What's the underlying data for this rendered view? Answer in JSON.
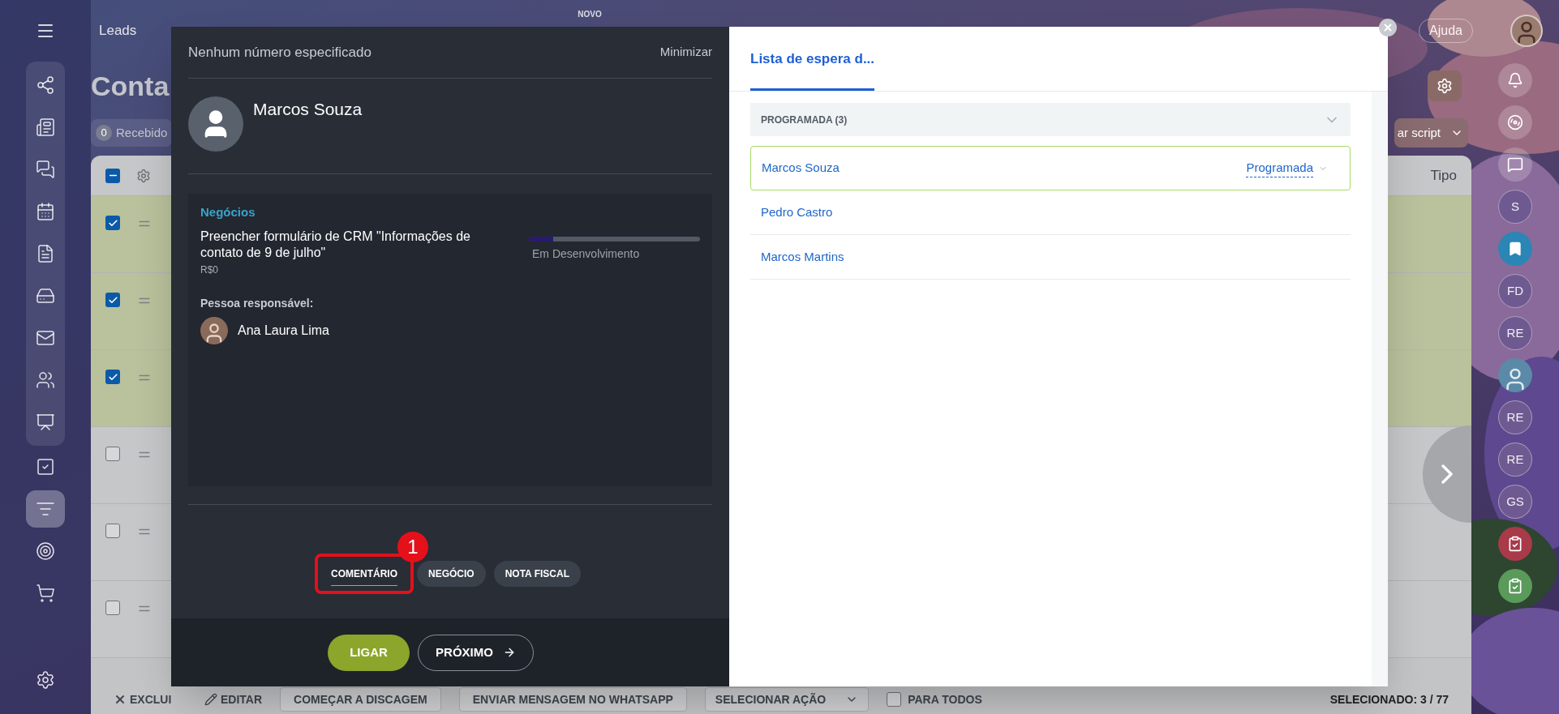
{
  "top_bar": {
    "nav_items": [
      {
        "label": "Leads"
      }
    ],
    "new_badge": "NOVO",
    "help_button": "Ajuda"
  },
  "left_sidebar": {
    "items": [
      {
        "selected": false
      },
      {
        "selected": false
      },
      {
        "selected": false
      },
      {
        "selected": false
      },
      {
        "selected": false
      },
      {
        "selected": false
      },
      {
        "selected": false
      },
      {
        "selected": false
      },
      {
        "selected": false
      },
      {
        "selected": false
      },
      {
        "selected": true
      },
      {
        "selected": false
      },
      {
        "selected": false
      }
    ]
  },
  "page": {
    "title": "Conta",
    "counter": {
      "count": "0",
      "label": "Recebido"
    },
    "script_button": "ar script"
  },
  "table": {
    "header_checkbox": {
      "indeterminate": true
    },
    "last_column": "Tipo",
    "rows": [
      {
        "checked": true
      },
      {
        "checked": true
      },
      {
        "checked": true
      },
      {
        "checked": false
      },
      {
        "checked": false
      },
      {
        "checked": false
      }
    ]
  },
  "bottom_bar": {
    "actions": [
      {
        "kind": "delete",
        "label": "EXCLUI"
      },
      {
        "kind": "edit",
        "label": "EDITAR"
      },
      {
        "kind": "button",
        "label": "COMEÇAR A DISCAGEM"
      },
      {
        "kind": "button",
        "label": "ENVIAR MENSAGEM NO WHATSAPP"
      },
      {
        "kind": "select",
        "label": "SELECIONAR AÇÃO"
      }
    ],
    "for_all": {
      "label": "PARA TODOS",
      "checked": false
    },
    "selected_label": "SELECIONADO:",
    "selected_count": "3 / 77"
  },
  "right_rail": {
    "items": [
      {
        "kind": "bell"
      },
      {
        "kind": "pulse"
      },
      {
        "kind": "chat-swap"
      },
      {
        "kind": "initials",
        "label": "S"
      },
      {
        "kind": "bookmark"
      },
      {
        "kind": "initials",
        "label": "FD"
      },
      {
        "kind": "initials",
        "label": "RE"
      },
      {
        "kind": "avatar"
      },
      {
        "kind": "initials",
        "label": "RE"
      },
      {
        "kind": "initials",
        "label": "RE"
      },
      {
        "kind": "initials",
        "label": "GS"
      },
      {
        "kind": "task",
        "color": "#a83a4a"
      },
      {
        "kind": "task",
        "color": "#5a9a5a"
      }
    ]
  },
  "call_dialog": {
    "header": "Nenhum número especificado",
    "minimize": "Minimizar",
    "contact_name": "Marcos Souza",
    "deal": {
      "section": "Negócios",
      "title": "Preencher formulário de CRM \"Informações de contato de 9 de julho\"",
      "amount": "R$0",
      "stage": {
        "level": 0.14,
        "label": "Em Desenvolvimento"
      },
      "responsible_label": "Pessoa responsável:",
      "responsible_name": "Ana Laura Lima"
    },
    "tabs": [
      {
        "label": "COMENTÁRIO",
        "selected": true
      },
      {
        "label": "NEGÓCIO",
        "selected": false
      },
      {
        "label": "NOTA FISCAL",
        "selected": false
      }
    ],
    "annotation": "1",
    "call_button": "LIGAR",
    "next_button": "PRÓXIMO"
  },
  "queue_panel": {
    "tab": "Lista de espera d...",
    "group": {
      "label": "PROGRAMADA (3)",
      "expanded": true
    },
    "contacts": [
      {
        "name": "Marcos Souza",
        "selected": true,
        "status": "Programada"
      },
      {
        "name": "Pedro Castro",
        "selected": false
      },
      {
        "name": "Marcos Martins",
        "selected": false
      }
    ]
  }
}
